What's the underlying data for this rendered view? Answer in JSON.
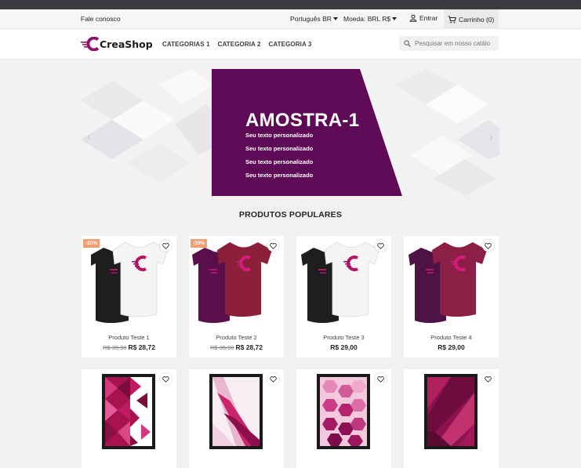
{
  "header": {
    "contact": "Fale conosco",
    "language": "Português BR",
    "currency": "Moeda: BRL R$",
    "login": "Entrar",
    "cart": "Carrinho (0)"
  },
  "brand": {
    "logo_text": "CreaShop"
  },
  "menu": [
    "CATEGORIAS 1",
    "CATEGORIA 2",
    "CATEGORIA 3"
  ],
  "search": {
    "placeholder": "Pesquisar em nosso catálo"
  },
  "banner": {
    "title": "AMOSTRA-1",
    "lines": [
      "Seu texto personalizado",
      "Seu texto personalizado",
      "Seu texto personalizado",
      "Seu texto personalizado"
    ],
    "prev": "‹",
    "next": "›"
  },
  "section_title": "PRODUTOS POPULARES",
  "products": [
    {
      "name": "Produto Teste 1",
      "old_price": "R$ 35,90",
      "price": "R$ 28,72",
      "badge": "-20%",
      "variant": "black-white"
    },
    {
      "name": "Produto Teste 2",
      "old_price": "R$ 35,90",
      "price": "R$ 28,72",
      "badge": "-20%",
      "variant": "purple-red"
    },
    {
      "name": "Produto Teste 3",
      "old_price": "",
      "price": "R$ 29,00",
      "badge": "",
      "variant": "black-white"
    },
    {
      "name": "Produto Teste 4",
      "old_price": "",
      "price": "R$ 29,00",
      "badge": "",
      "variant": "purple-red"
    }
  ],
  "posters": [
    "poster-triangles",
    "poster-swoosh",
    "poster-hexagons",
    "poster-diagonal"
  ],
  "colors": {
    "accent": "#5e0a57",
    "magenta": "#b4165f",
    "badge": "#f39d72"
  }
}
